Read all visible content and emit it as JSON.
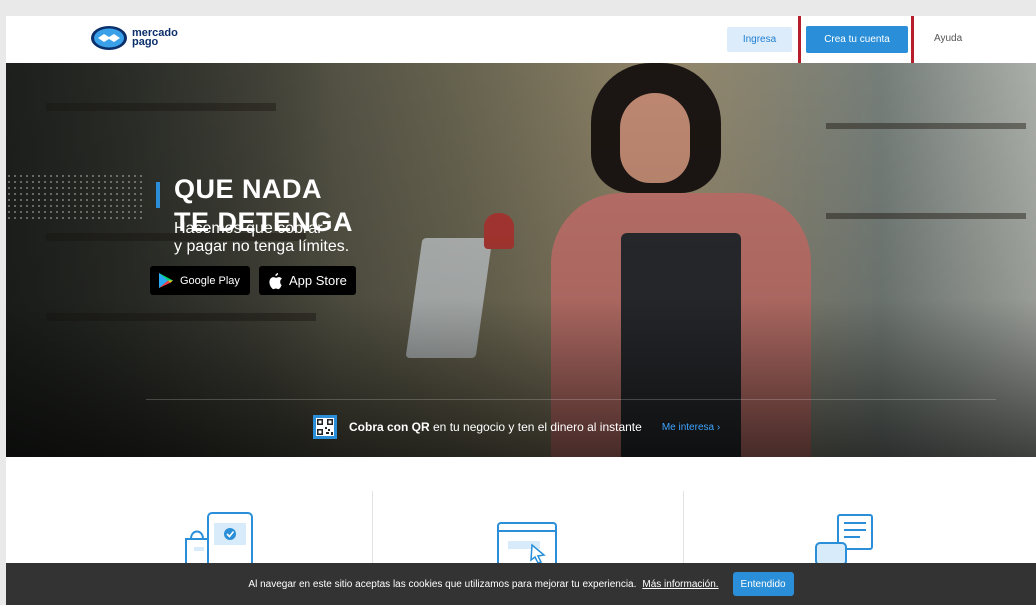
{
  "header": {
    "logo_line1": "mercado",
    "logo_line2": "pago",
    "login_label": "Ingresa",
    "signup_label": "Crea tu cuenta",
    "help_label": "Ayuda"
  },
  "hero": {
    "title_line1": "QUE NADA",
    "title_line2": "TE DETENGA",
    "subtitle_line1": "Hacemos que cobrar",
    "subtitle_line2": "y pagar no tenga límites.",
    "google_play_label": "Google Play",
    "app_store_label": "App Store",
    "qr_bold": "Cobra con QR",
    "qr_text": " en tu negocio y ten el dinero al instante",
    "qr_link": "Me interesa ›"
  },
  "cookie_banner": {
    "text": "Al navegar en este sitio aceptas las cookies que utilizamos para mejorar tu experiencia.",
    "link": "Más información.",
    "button": "Entendido"
  },
  "colors": {
    "accent": "#2a8fd8",
    "highlight": "#b71c2b",
    "login_bg": "#dcecfa"
  }
}
